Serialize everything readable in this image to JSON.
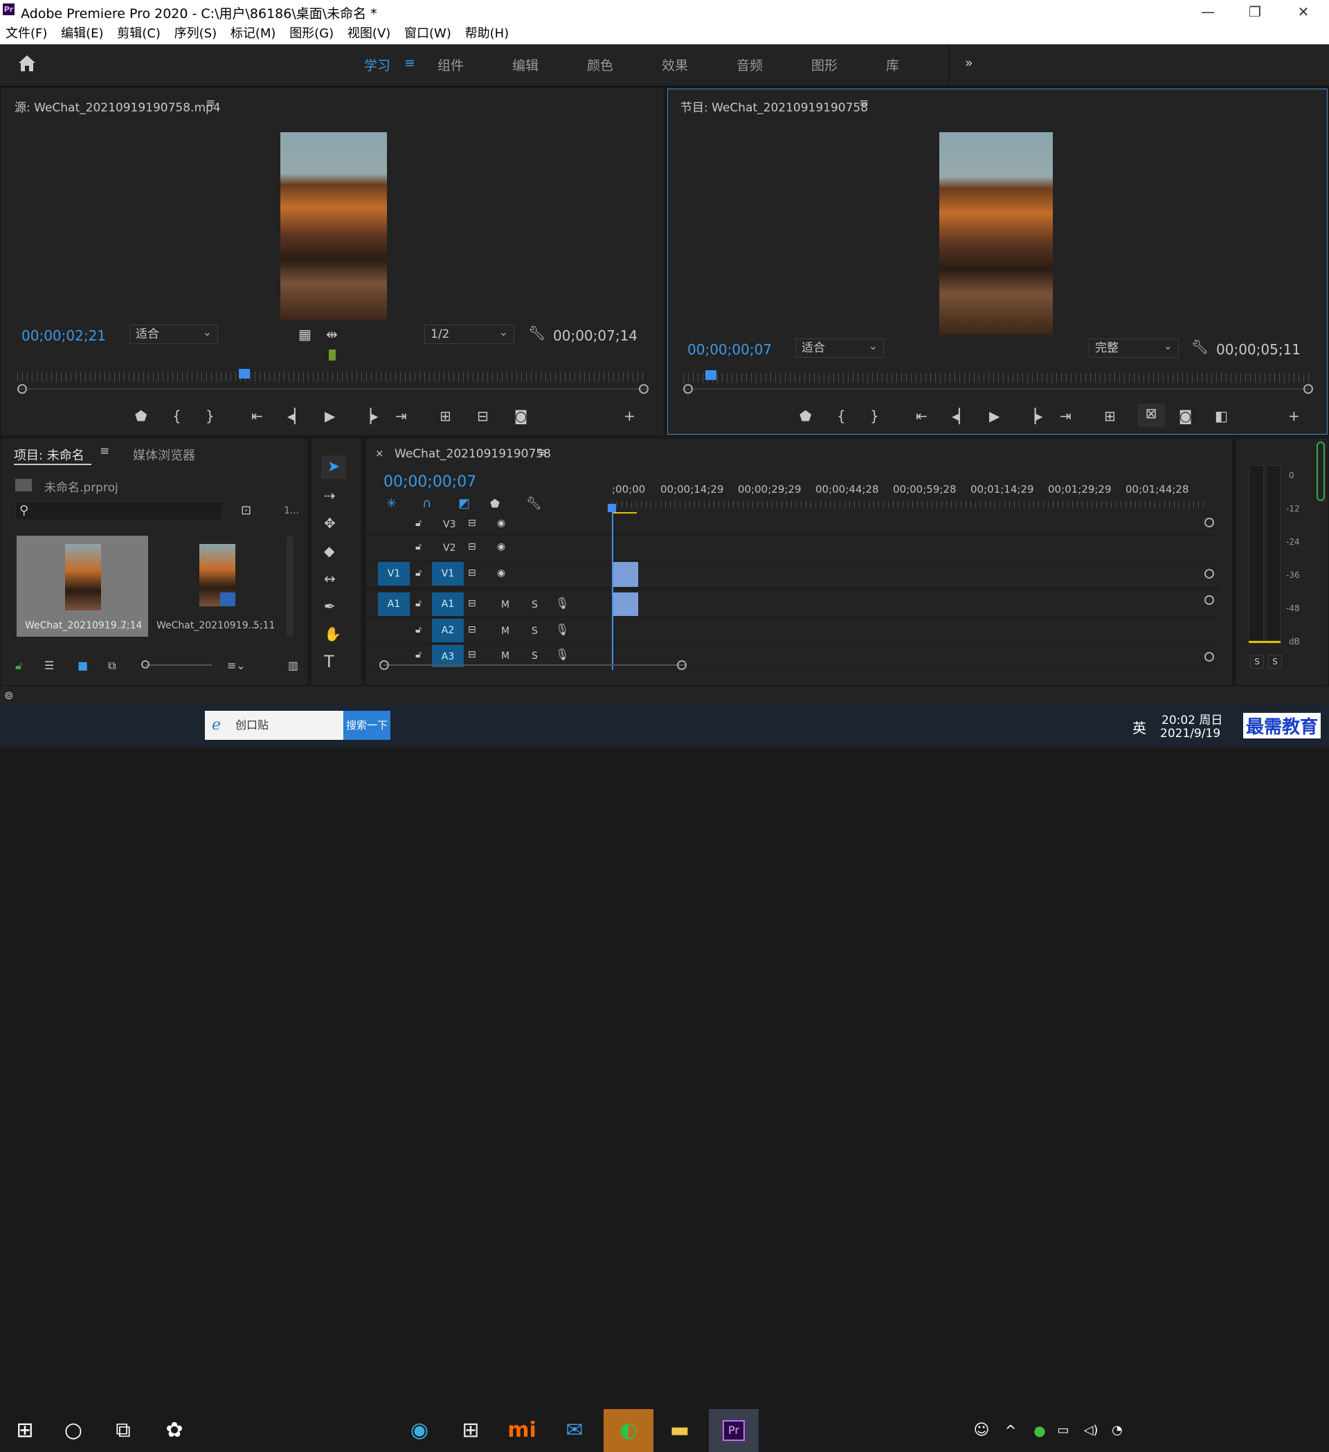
{
  "window": {
    "title": "Adobe Premiere Pro 2020 - C:\\用户\\86186\\桌面\\未命名 *",
    "app_icon": "Pr"
  },
  "menu": [
    "文件(F)",
    "编辑(E)",
    "剪辑(C)",
    "序列(S)",
    "标记(M)",
    "图形(G)",
    "视图(V)",
    "窗口(W)",
    "帮助(H)"
  ],
  "workspaces": [
    "学习",
    "组件",
    "编辑",
    "颜色",
    "效果",
    "音频",
    "图形",
    "库"
  ],
  "source": {
    "title": "源: WeChat_20210919190758.mp4",
    "timecode": "00;00;02;21",
    "fit": "适合",
    "resolution": "1/2",
    "duration": "00;00;07;14"
  },
  "program": {
    "title": "节目: WeChat_20210919190758",
    "timecode": "00;00;00;07",
    "fit": "适合",
    "quality": "完整",
    "duration": "00;00;05;11"
  },
  "project": {
    "tab": "项目: 未命名",
    "tab2": "媒体浏览器",
    "file": "未命名.prproj",
    "count": "1...",
    "items": [
      {
        "name": "WeChat_20210919...",
        "duration": "7;14"
      },
      {
        "name": "WeChat_20210919...",
        "duration": "5;11"
      }
    ]
  },
  "timeline": {
    "tab": "WeChat_20210919190758",
    "close": "×",
    "timecode": "00;00;00;07",
    "ruler": [
      ";00;00",
      "00;00;14;29",
      "00;00;29;29",
      "00;00;44;28",
      "00;00;59;28",
      "00;01;14;29",
      "00;01;29;29",
      "00;01;44;28"
    ],
    "video_tracks": [
      {
        "name": "V3",
        "source": ""
      },
      {
        "name": "V2",
        "source": ""
      },
      {
        "name": "V1",
        "source": "V1"
      }
    ],
    "audio_tracks": [
      {
        "name": "A1",
        "source": "A1"
      },
      {
        "name": "A2",
        "source": ""
      },
      {
        "name": "A3",
        "source": ""
      }
    ],
    "m": "M",
    "s": "S"
  },
  "meter": {
    "labels": [
      "0",
      "-12",
      "-24",
      "-36",
      "-48",
      "dB"
    ],
    "solo": "S"
  },
  "taskbar": {
    "search_text": "创口贴",
    "search_button": "搜索一下",
    "time": "20:02 周日",
    "date": "2021/9/19",
    "ime": "英",
    "watermark": "最需教育"
  },
  "colors": {
    "accent": "#3a9ae8",
    "track_blue": "#135a8e",
    "clip": "#7b9fd8",
    "playhead": "#3e8ef0"
  }
}
